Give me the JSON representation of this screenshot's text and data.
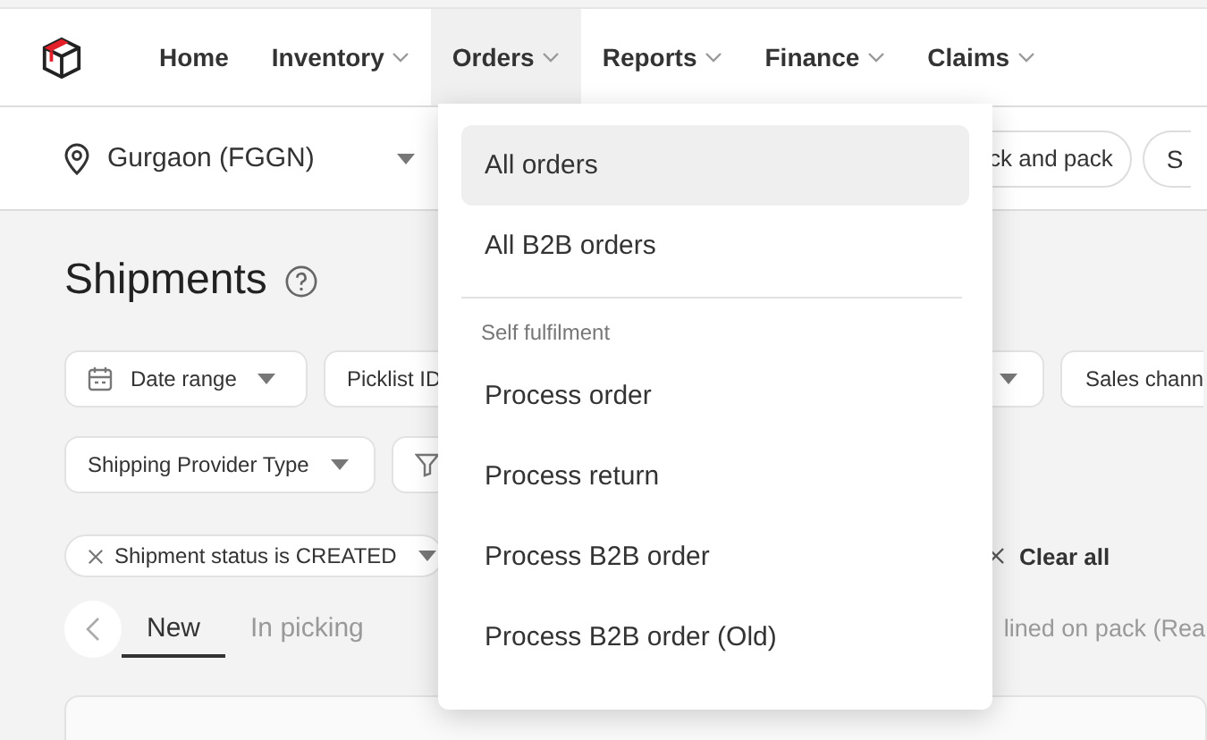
{
  "nav": [
    {
      "label": "Home",
      "has_menu": false,
      "selected": false
    },
    {
      "label": "Inventory",
      "has_menu": true,
      "selected": false
    },
    {
      "label": "Orders",
      "has_menu": true,
      "selected": true
    },
    {
      "label": "Reports",
      "has_menu": true,
      "selected": false
    },
    {
      "label": "Finance",
      "has_menu": true,
      "selected": false
    },
    {
      "label": "Claims",
      "has_menu": true,
      "selected": false
    }
  ],
  "location": {
    "value": "Gurgaon (FGGN)"
  },
  "actions": [
    "ck and pack",
    "S"
  ],
  "page": {
    "title": "Shipments"
  },
  "filters": [
    {
      "kind": "date",
      "label": "Date range"
    },
    {
      "kind": "plain",
      "label": "Picklist ID"
    },
    {
      "kind": "caret"
    },
    {
      "kind": "plain",
      "label": "Sales chann"
    },
    {
      "kind": "break"
    },
    {
      "kind": "select",
      "label": "Shipping Provider Type"
    },
    {
      "kind": "funnel"
    }
  ],
  "chips": [
    {
      "label": "Shipment status is CREATED"
    }
  ],
  "clear_all": "Clear all",
  "tabs": [
    {
      "label": "New",
      "selected": true
    },
    {
      "label": "In picking",
      "selected": false
    },
    {
      "label": "lined on pack (Rea",
      "selected": false
    }
  ],
  "menu": [
    {
      "kind": "item",
      "label": "All orders",
      "selected": true
    },
    {
      "kind": "item",
      "label": "All B2B orders",
      "selected": false
    },
    {
      "kind": "divider"
    },
    {
      "kind": "header",
      "label": "Self fulfilment"
    },
    {
      "kind": "item",
      "label": "Process order",
      "selected": false
    },
    {
      "kind": "item",
      "label": "Process return",
      "selected": false
    },
    {
      "kind": "item",
      "label": "Process B2B order",
      "selected": false
    },
    {
      "kind": "item",
      "label": "Process B2B order (Old)",
      "selected": false
    }
  ]
}
